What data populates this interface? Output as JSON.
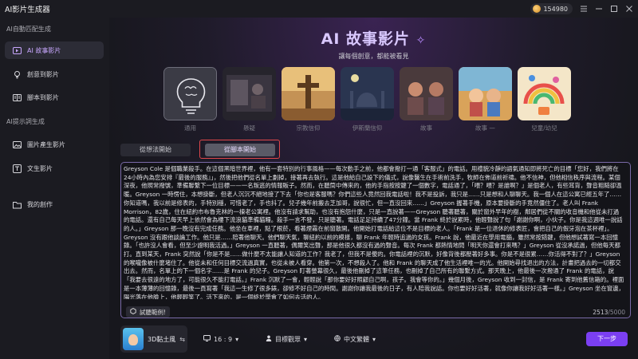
{
  "app": {
    "title": "AI影片生成器",
    "coins": "154980"
  },
  "sidebar": {
    "group1": "AI自動匹配生成",
    "items1": [
      {
        "label": "AI 故事影片",
        "icon": "sparkle-icon"
      },
      {
        "label": "創意到影片",
        "icon": "bulb-icon"
      },
      {
        "label": "腳本到影片",
        "icon": "script-icon"
      }
    ],
    "group2": "AI提示詞生成",
    "items2": [
      {
        "label": "圖片產生影片",
        "icon": "image-icon"
      },
      {
        "label": "文生影片",
        "icon": "text-icon"
      }
    ],
    "creations": {
      "label": "我的創作",
      "icon": "folder-icon"
    }
  },
  "hero": {
    "title": "AI 故事影片",
    "subtitle": "讓每個創意，都能被看見"
  },
  "templates": [
    {
      "label": "通用"
    },
    {
      "label": "懸疑"
    },
    {
      "label": "宗教信仰"
    },
    {
      "label": "伊斯蘭信仰"
    },
    {
      "label": "故事"
    },
    {
      "label": "故事 —"
    },
    {
      "label": "兒童/幼兒"
    }
  ],
  "tabs": {
    "idea": "從想法開始",
    "script": "從腳本開始"
  },
  "editor": {
    "text": "Greyson Cole 是個職業殺手。在這個黑暗世界裡，他有一套特別的行事風格——每次動手之前，他都會撥打一通「客服式」的電話。用禮貌冷靜的語氣通知即將死亡的目標「您好，我們將在24小時內為您安排『最後的服務』」，然後把他們從名單上劃掉，接著再去執行。這是他給自己設下的儀式，說像醫生在手術前洗手，牧師在佈道前祈禱。他不信神，但他相信秩序與流程。某個深夜，他照常撥號，準備聯繫下一位目標——一名叛逃的情報販子。然而，在聽筒中傳來的，他的手指按按鍵了一個數字，電話通了，「喂？喂？是誰啊？」是個老人，有些耳背，聲音粗糙卻溫暖。Greyson 一時愣住，本想掛斷，但老人沉沉不絕地接了下去「你也是客服嗎？你們這些人竟然回我電話啦！我不是投訴，我只是……只是想和人聊聊天。我一個人在這公寓已經五年了……你知道嗎，我以前是修表的，手特別穩，可惜老了，手也抖了。兒子幾年前搬去芝加哥，說很忙，但一直沒回來……」Greyson 握著手機，原本要掛斷的手竟然僵住了。老人叫 Frank Morrison，82歲，住在紐約市布魯克林的一棟老公寓裡。他沒有請求幫助，也沒有抱怨什麼，只是一直說著——Greyson 聽著聽著，關於窗外早年的樹，鄰居們從不關的收音機和他從未打過的電話。還有自己每天早上依然會為樓下流浪貓準備貓糧。殺手一言不發，只是聽著。電話足足持續了47分鐘。當 Frank 終於說累時，他輕聲說了句「謝謝你啊，小伙子。你是我這週唯一說話的人。」Greyson 那一晚沒有完成任務。他坐在車裡，點了根菸，看著煙霧在前窗散開。他開始打電話給這位不是目標的老人。「Frank 是一位退休的修表匠，會把自己的假牙泡在茶杯裡」。Greyson 沒有跟他談論工作。他只是……陪著他聊天。他們聊天氣，聊紐約以前的模樣，聊 Frank 年輕時追過的女孩。Frank 說，他最近在學用電腦，雖然常按錯鍵，但他想試著寫一本回憶錄。「也許沒人會看，但至少證明我活過。」Greyson 一直聽著，偶爾笑出聲，那是他很久都沒有過的聲音。每次 Frank 都熱情地問「明天你還會打來嗎？」Greyson 從沒承諾過，但他每天都打。直到某天，Frank 突然說「你是不是……做什麼不太能讓人知道的工作？我老了，但我不是傻的。你電話裡的沉默，好像背後都壓著好多事。你是不是很累……你活得不對了？」Greyson 的喉嚨像被什麼堵住了。他從未和任何目標交流過真實，也從未被人看穿。他第一次，不想殺人了。他和 Frank 的聊天成了他生活裡唯一的光。他開始尋找退出的方法，計畫把過去的一切都交出去。然而，名單上的下一個名字……是 Frank 的兒子。Greyson 盯著螢幕很久，最後他刪掉了這筆任務，也刪掉了自己所有的聯繫方式。那天晚上，他最後一次撥通了 Frank 的電話，說「我要去很遠的地方了，可能很久不能打電話。」Frank 沉默了一會，輕輕說「那你要好好照顧自己啊，孩子。我會等你的。」幾個月後，Greyson 收到一封信，是 Frank 寄到他舊信箱的。裡面是一本薄薄的回憶錄，最後一頁寫著「我這一生修了很多錶，卻修不好自己的時間。謝謝你讓我最後的日子，有人陪我說話。你也要好好活著，就像你讓我好好活著一樣。」Greyson 坐在窗邊，陽光落在他臉上，他輕輕笑了。活下來的，是一個終於學會了如何去活的人。",
    "count": "2513",
    "max": "/5000",
    "example_label": "試聽範例!"
  },
  "bottom": {
    "voice_name": "3D黏土風",
    "ratio": "16 : 9",
    "audience": "目標觀眾",
    "language": "中文繁體",
    "next_label": "下一步"
  },
  "colors": {
    "accent": "#7b3ff2",
    "highlight": "#e0474b"
  }
}
